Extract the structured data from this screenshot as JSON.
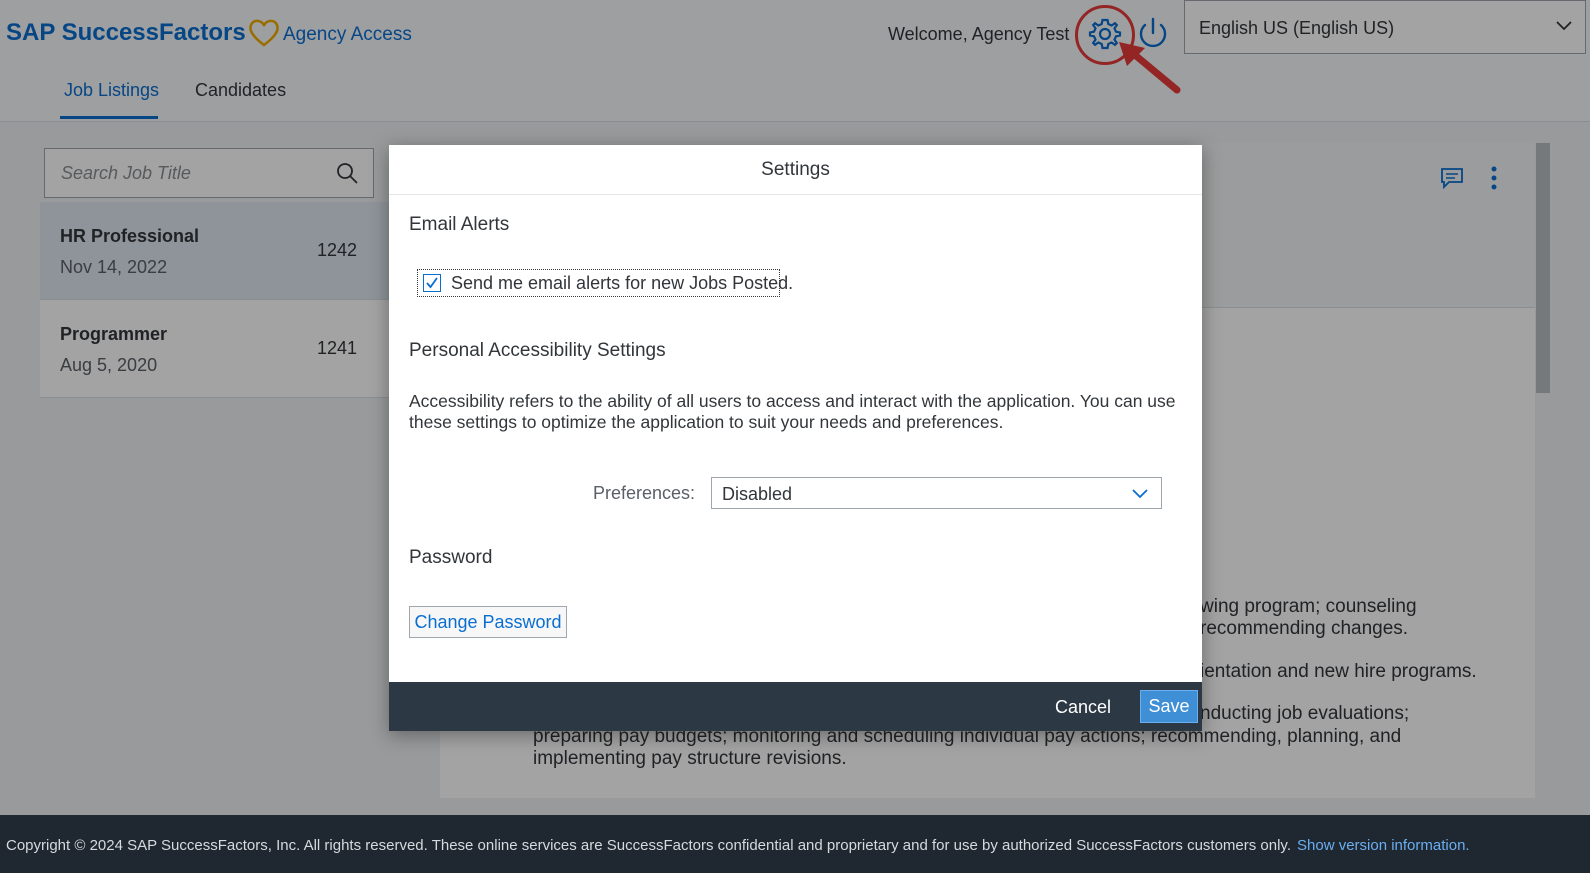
{
  "header": {
    "brand": "SAP SuccessFactors",
    "app_name": "Agency Access",
    "welcome": "Welcome,  Agency  Test",
    "language": "English US (English US)",
    "tabs": [
      {
        "label": "Job Listings"
      },
      {
        "label": "Candidates"
      }
    ]
  },
  "sidebar": {
    "search_placeholder": "Search Job Title",
    "items": [
      {
        "title": "HR Professional",
        "date": "Nov 14, 2022",
        "id": "1242"
      },
      {
        "title": "Programmer",
        "date": "Aug 5, 2020",
        "id": "1241"
      }
    ]
  },
  "main": {
    "lines": [
      "wing program; counseling",
      "recommending changes.",
      "ientation and new hire programs.",
      "nducting job evaluations;",
      "preparing pay budgets; monitoring and scheduling individual pay actions; recommending, planning, and",
      "implementing pay structure revisions."
    ]
  },
  "dialog": {
    "title": "Settings",
    "email_section": "Email Alerts",
    "email_checkbox_label": "Send me email alerts for new Jobs Posted.",
    "email_checked": true,
    "accessibility_section": "Personal Accessibility Settings",
    "accessibility_text": "Accessibility refers to the ability of all users to access and interact with the application. You can use these settings to optimize the application to suit your needs and preferences.",
    "preferences_label": "Preferences:",
    "preferences_value": "Disabled",
    "password_section": "Password",
    "change_password": "Change Password",
    "cancel": "Cancel",
    "save": "Save"
  },
  "footer": {
    "copyright": "Copyright © 2024 SAP SuccessFactors, Inc. All rights reserved. These online services are SuccessFactors confidential and proprietary and for use by authorized SuccessFactors customers only.",
    "version_link": "Show version information."
  },
  "colors": {
    "brand_blue": "#0a6ed1",
    "highlight_red": "#e63a3a",
    "save_blue": "#3f8fd6"
  }
}
